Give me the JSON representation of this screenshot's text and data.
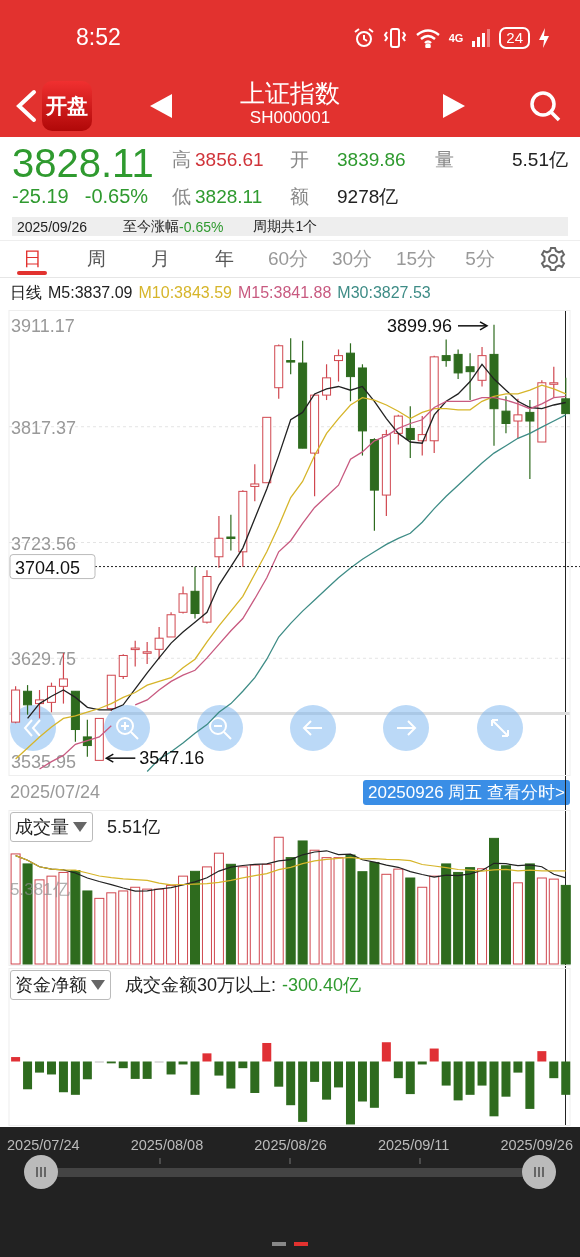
{
  "status_bar": {
    "time": "8:52",
    "network": "4G",
    "battery": "24"
  },
  "header": {
    "logo": "开盘",
    "title": "上证指数",
    "code": "SH000001"
  },
  "quote": {
    "price": "3828.11",
    "change": "-25.19",
    "change_pct": "-0.65%",
    "color": "#2f9a2f",
    "fields": [
      {
        "label": "高",
        "value": "3856.61",
        "color": "#d0343a"
      },
      {
        "label": "开",
        "value": "3839.86",
        "color": "#2f9a2f"
      },
      {
        "label": "量",
        "value": "5.51亿",
        "color": "#222222"
      },
      {
        "label": "低",
        "value": "3828.11",
        "color": "#2f9a2f"
      },
      {
        "label": "额",
        "value": "9278亿",
        "color": "#222222"
      }
    ]
  },
  "range_bar": {
    "date": "2025/09/26",
    "change_label": "至今涨幅",
    "change": {
      "text": "-0.65%",
      "color": "#2f9a2f"
    },
    "periods": "周期共1个"
  },
  "period_tabs": [
    {
      "label": "日",
      "kind": "day",
      "selected": true
    },
    {
      "label": "周",
      "kind": "day",
      "selected": false
    },
    {
      "label": "月",
      "kind": "day",
      "selected": false
    },
    {
      "label": "年",
      "kind": "day",
      "selected": false
    },
    {
      "label": "60分",
      "kind": "minute",
      "selected": false
    },
    {
      "label": "30分",
      "kind": "minute",
      "selected": false
    },
    {
      "label": "15分",
      "kind": "minute",
      "selected": false
    },
    {
      "label": "5分",
      "kind": "minute",
      "selected": false
    }
  ],
  "ma_legend": {
    "title": "日线"
  },
  "price_chart": {
    "chart_data": {
      "type": "candlestick",
      "grid": true,
      "ylim": [
        3535.95,
        3911.17
      ],
      "yticks": [
        3535.95,
        3629.75,
        3723.56,
        3817.37,
        3911.17
      ],
      "ohlc": [
        [
          3578,
          3607,
          3577,
          3604
        ],
        [
          3603,
          3608,
          3584,
          3592
        ],
        [
          3593,
          3604,
          3581,
          3596
        ],
        [
          3594,
          3610,
          3586,
          3607
        ],
        [
          3607,
          3634,
          3593,
          3613
        ],
        [
          3603,
          3603,
          3562,
          3572
        ],
        [
          3566,
          3580,
          3550,
          3559
        ],
        [
          3547,
          3581,
          3547,
          3581
        ],
        [
          3589,
          3616,
          3587,
          3616
        ],
        [
          3615,
          3633,
          3613,
          3632
        ],
        [
          3637,
          3644,
          3623,
          3638
        ],
        [
          3634,
          3643,
          3625,
          3635
        ],
        [
          3637,
          3655,
          3629,
          3646
        ],
        [
          3647,
          3667,
          3647,
          3665
        ],
        [
          3667,
          3688,
          3666,
          3682
        ],
        [
          3684,
          3704,
          3662,
          3666
        ],
        [
          3659,
          3701,
          3658,
          3696
        ],
        [
          3712,
          3745,
          3703,
          3727
        ],
        [
          3728,
          3746,
          3717,
          3727
        ],
        [
          3716,
          3766,
          3704,
          3765
        ],
        [
          3769,
          3787,
          3757,
          3771
        ],
        [
          3772,
          3825,
          3772,
          3825
        ],
        [
          3849,
          3884,
          3840,
          3883
        ],
        [
          3871,
          3889,
          3860,
          3870
        ],
        [
          3869,
          3887,
          3800,
          3800
        ],
        [
          3796,
          3844,
          3761,
          3843
        ],
        [
          3843,
          3868,
          3839,
          3857
        ],
        [
          3871,
          3880,
          3854,
          3875
        ],
        [
          3877,
          3885,
          3838,
          3858
        ],
        [
          3865,
          3868,
          3794,
          3814
        ],
        [
          3807,
          3808,
          3733,
          3766
        ],
        [
          3762,
          3815,
          3745,
          3811
        ],
        [
          3812,
          3827,
          3803,
          3826
        ],
        [
          3816,
          3834,
          3792,
          3807
        ],
        [
          3806,
          3826,
          3794,
          3811
        ],
        [
          3806,
          3875,
          3796,
          3874
        ],
        [
          3875,
          3888,
          3866,
          3871
        ],
        [
          3876,
          3880,
          3856,
          3861
        ],
        [
          3866,
          3877,
          3839,
          3862
        ],
        [
          3855,
          3882,
          3850,
          3875
        ],
        [
          3876,
          3900,
          3802,
          3832
        ],
        [
          3830,
          3842,
          3812,
          3820
        ],
        [
          3822,
          3840,
          3808,
          3827
        ],
        [
          3829,
          3839,
          3775,
          3822
        ],
        [
          3805,
          3855,
          3805,
          3853
        ],
        [
          3852,
          3866,
          3841,
          3853
        ],
        [
          3840,
          3857,
          3828,
          3828
        ]
      ],
      "series": [
        {
          "name": "M5:3837.09",
          "type": "line",
          "color": "#222222",
          "values": [
            null,
            3581,
            3593,
            3599,
            3604,
            3598,
            3590,
            3588,
            3588,
            3592,
            3605,
            3618,
            3630,
            3642,
            3651,
            3659,
            3667,
            3689,
            3704,
            3719,
            3743,
            3767,
            3794,
            3823,
            3829,
            3844,
            3848,
            3850,
            3847,
            3850,
            3838,
            3824,
            3812,
            3805,
            3804,
            3827,
            3838,
            3844,
            3854,
            3868,
            3856,
            3847,
            3838,
            3833,
            3832,
            3835,
            3837
          ]
        },
        {
          "name": "M10:3843.59",
          "type": "line",
          "color": "#d6b52a",
          "values": [
            3548,
            3557,
            3566,
            3574,
            3581,
            3583,
            3586,
            3589,
            3593,
            3598,
            3602,
            3608,
            3611,
            3614,
            3622,
            3629,
            3643,
            3656,
            3668,
            3680,
            3698,
            3716,
            3737,
            3760,
            3773,
            3794,
            3812,
            3824,
            3835,
            3841,
            3839,
            3835,
            3830,
            3824,
            3829,
            3832,
            3832,
            3831,
            3831,
            3838,
            3842,
            3844,
            3844,
            3847,
            3851,
            3848,
            3844
          ]
        },
        {
          "name": "M15:3841.88",
          "type": "line",
          "color": "#c85a80",
          "values": [
            null,
            null,
            3540,
            3546,
            3551,
            3560,
            3563,
            3566,
            3575,
            null,
            3592,
            3596,
            3604,
            3611,
            3616,
            3620,
            3630,
            3641,
            3652,
            3662,
            3678,
            3695,
            3716,
            3725,
            3739,
            3752,
            3761,
            3770,
            3791,
            3797,
            3806,
            3810,
            3816,
            3820,
            3823,
            3833,
            3838,
            3838,
            3838,
            3841,
            3841,
            3839,
            3836,
            3832,
            3836,
            3841,
            3842
          ]
        },
        {
          "name": "M30:3827.53",
          "type": "line",
          "color": "#3e8c86",
          "values": [
            null,
            null,
            null,
            null,
            null,
            null,
            null,
            null,
            null,
            null,
            null,
            3538,
            3548,
            3554,
            3561,
            3569,
            3576,
            3586,
            3593,
            3603,
            3614,
            3629,
            3647,
            3658,
            3668,
            3677,
            3686,
            3695,
            3703,
            3710,
            3716,
            3722,
            3727,
            3731,
            3740,
            3751,
            3761,
            3770,
            3779,
            3788,
            3796,
            3802,
            3808,
            3812,
            3817,
            3822,
            3827
          ]
        }
      ],
      "ref_lines": [
        {
          "axis": "y",
          "value": 3704.05,
          "label": "3704.05"
        }
      ],
      "annotations": [
        "3899.96",
        "3547.16"
      ]
    }
  },
  "date_row": {
    "start_date": "2025/07/24",
    "detail_link": "20250926 周五 查看分时>"
  },
  "volume_panel": {
    "selector": "成交量",
    "reading": "5.51亿",
    "axis_label": "5.381亿"
  },
  "fund_panel": {
    "selector": "资金净额",
    "caption": "成交金额30万以上:",
    "value": {
      "text": "-300.40亿",
      "color": "#2f9a2f"
    }
  },
  "navigator": {
    "dates": [
      "2025/07/24",
      "2025/08/08",
      "2025/08/26",
      "2025/09/11",
      "2025/09/26"
    ],
    "pages": [
      {
        "selected": false
      },
      {
        "selected": true
      }
    ]
  }
}
